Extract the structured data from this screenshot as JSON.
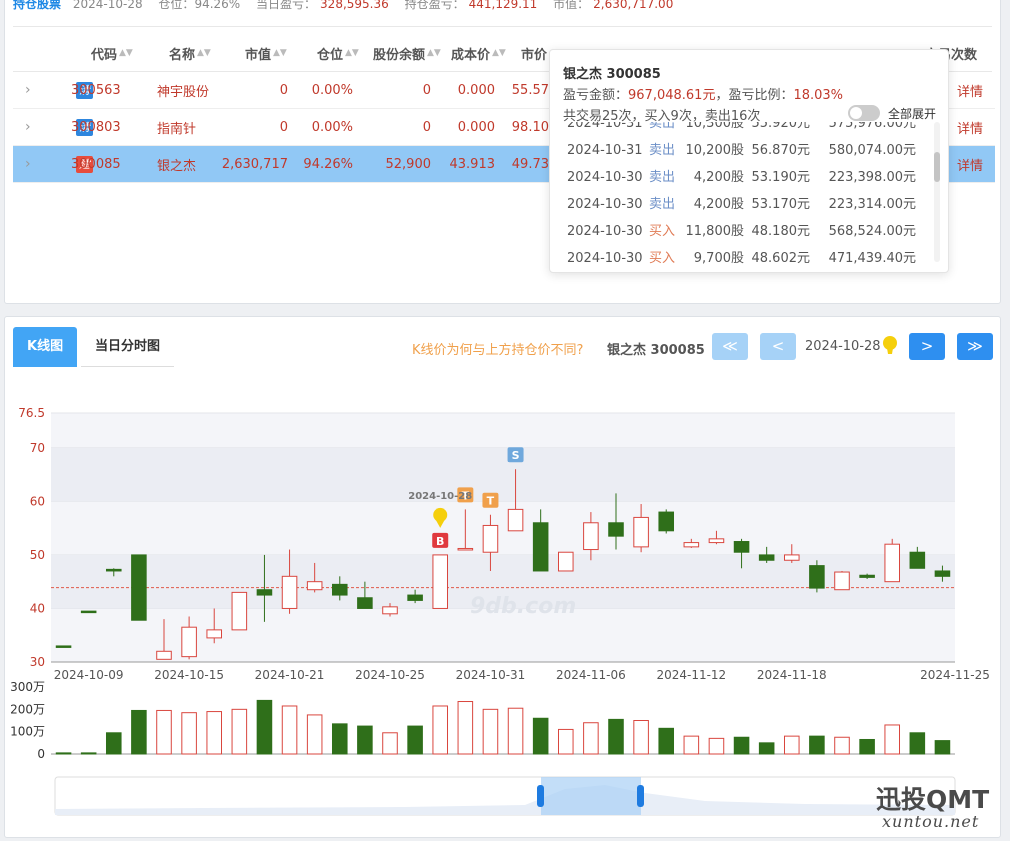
{
  "summary": {
    "label": "持仓股票",
    "date": "2024-10-28",
    "position_label": "仓位：",
    "position_value": "94.26%",
    "daily_pl_label": "当日盈亏：",
    "daily_pl_value": "328,595.36",
    "hold_pl_label": "持仓盈亏：",
    "hold_pl_value": "441,129.11",
    "mv_label": "市值：",
    "mv_value": "2,630,717.00"
  },
  "table": {
    "headers": {
      "code": "代码",
      "name": "名称",
      "mv": "市值",
      "pos": "仓位",
      "shares": "股份余额",
      "cost": "成本价",
      "price": "市价",
      "trades": "交易次数"
    },
    "rows": [
      {
        "code": "300563",
        "badge": "清",
        "badge_type": "clear",
        "name": "神宇股份",
        "mv": "0",
        "pos": "0.00%",
        "shares": "0",
        "cost": "0.000",
        "price": "55.57",
        "detail": "详情"
      },
      {
        "code": "300803",
        "badge": "清",
        "badge_type": "clear",
        "name": "指南针",
        "mv": "0",
        "pos": "0.00%",
        "shares": "0",
        "cost": "0.000",
        "price": "98.10",
        "detail": "详情"
      },
      {
        "code": "300085",
        "badge": "建",
        "badge_type": "build",
        "name": "银之杰",
        "mv": "2,630,717",
        "pos": "94.26%",
        "shares": "52,900",
        "cost": "43.913",
        "price": "49.73",
        "detail": "详情"
      }
    ]
  },
  "popup": {
    "title": "银之杰 300085",
    "pl_label": "盈亏金额：",
    "pl_value": "967,048.61元",
    "ratio_label": "，盈亏比例：",
    "ratio_value": "18.03%",
    "count_text": "共交易25次，买入9次，卖出16次",
    "toggle_label": "全部展开",
    "trades": [
      {
        "date": "2024-10-31",
        "side": "卖出",
        "type": "sell",
        "qty": "10,300股",
        "price": "55.920元",
        "amount": "575,976.00元"
      },
      {
        "date": "2024-10-31",
        "side": "卖出",
        "type": "sell",
        "qty": "10,200股",
        "price": "56.870元",
        "amount": "580,074.00元"
      },
      {
        "date": "2024-10-30",
        "side": "卖出",
        "type": "sell",
        "qty": "4,200股",
        "price": "53.190元",
        "amount": "223,398.00元"
      },
      {
        "date": "2024-10-30",
        "side": "卖出",
        "type": "sell",
        "qty": "4,200股",
        "price": "53.170元",
        "amount": "223,314.00元"
      },
      {
        "date": "2024-10-30",
        "side": "买入",
        "type": "buy",
        "qty": "11,800股",
        "price": "48.180元",
        "amount": "568,524.00元"
      },
      {
        "date": "2024-10-30",
        "side": "买入",
        "type": "buy",
        "qty": "9,700股",
        "price": "48.602元",
        "amount": "471,439.40元"
      }
    ]
  },
  "chart_tabs": {
    "kline": "K线图",
    "intraday": "当日分时图"
  },
  "chart_header": {
    "why_link": "K线价为何与上方持仓价不同?",
    "stock": "银之杰 300085",
    "first_btn": "≪",
    "prev_btn": "<",
    "date": "2024-10-28",
    "next_btn": ">",
    "last_btn": "≫"
  },
  "watermark": {
    "logo": "迅投QMT",
    "url": "xuntou.net",
    "site": "9db.com"
  },
  "colors": {
    "up": "#d9463e",
    "down": "#2f6f1a",
    "accent": "#42a5f5",
    "avgline": "#e05a4a"
  },
  "chart_data": {
    "type": "candlestick",
    "y_ticks": [
      "76.5",
      "70",
      "60",
      "50",
      "40",
      "30"
    ],
    "ylim": [
      30,
      76.5
    ],
    "x_ticks": [
      "2024-10-09",
      "2024-10-15",
      "2024-10-21",
      "2024-10-25",
      "2024-10-31",
      "2024-11-06",
      "2024-11-12",
      "2024-11-18",
      "2024-11-25"
    ],
    "cost_line": 43.9,
    "volume_ticks": [
      "300万",
      "200万",
      "100万",
      "0"
    ],
    "volume_max": 300,
    "candles": [
      {
        "o": 33,
        "c": 33,
        "h": 33,
        "l": 33,
        "v": 5,
        "up": false
      },
      {
        "o": 39.5,
        "c": 39.5,
        "h": 39.5,
        "l": 39.5,
        "v": 5,
        "up": false
      },
      {
        "o": 47.3,
        "c": 47,
        "h": 47.5,
        "l": 46,
        "v": 95,
        "up": false
      },
      {
        "o": 50,
        "c": 37.8,
        "h": 50,
        "l": 37.8,
        "v": 195,
        "up": false
      },
      {
        "o": 30.5,
        "c": 32,
        "h": 38,
        "l": 30.5,
        "v": 195,
        "up": true
      },
      {
        "o": 31,
        "c": 36.5,
        "h": 38.5,
        "l": 30.5,
        "v": 185,
        "up": true
      },
      {
        "o": 34.5,
        "c": 36,
        "h": 40,
        "l": 33.5,
        "v": 190,
        "up": true
      },
      {
        "o": 36,
        "c": 43,
        "h": 43,
        "l": 36,
        "v": 200,
        "up": true
      },
      {
        "o": 43.5,
        "c": 42.5,
        "h": 50,
        "l": 37.5,
        "v": 240,
        "up": false
      },
      {
        "o": 40,
        "c": 46,
        "h": 51,
        "l": 39,
        "v": 215,
        "up": true
      },
      {
        "o": 43.5,
        "c": 45,
        "h": 48.5,
        "l": 43,
        "v": 175,
        "up": true
      },
      {
        "o": 44.5,
        "c": 42.5,
        "h": 46,
        "l": 41.5,
        "v": 135,
        "up": false
      },
      {
        "o": 42,
        "c": 40,
        "h": 45,
        "l": 40,
        "v": 125,
        "up": false
      },
      {
        "o": 39,
        "c": 40.3,
        "h": 41,
        "l": 38.5,
        "v": 95,
        "up": true
      },
      {
        "o": 42.5,
        "c": 41.5,
        "h": 43.5,
        "l": 41,
        "v": 125,
        "up": false
      },
      {
        "o": 40,
        "c": 50,
        "h": 50,
        "l": 40,
        "v": 215,
        "up": true
      },
      {
        "o": 51,
        "c": 51.2,
        "h": 58.5,
        "l": 51,
        "v": 235,
        "up": true
      },
      {
        "o": 50.5,
        "c": 55.5,
        "h": 57.5,
        "l": 47,
        "v": 200,
        "up": true
      },
      {
        "o": 54.5,
        "c": 58.5,
        "h": 66,
        "l": 54.5,
        "v": 205,
        "up": true
      },
      {
        "o": 56,
        "c": 47,
        "h": 58.5,
        "l": 47,
        "v": 160,
        "up": false
      },
      {
        "o": 47,
        "c": 50.5,
        "h": 50.5,
        "l": 47,
        "v": 110,
        "up": true
      },
      {
        "o": 51,
        "c": 56,
        "h": 58,
        "l": 49,
        "v": 140,
        "up": true
      },
      {
        "o": 56,
        "c": 53.5,
        "h": 61.5,
        "l": 51,
        "v": 155,
        "up": false
      },
      {
        "o": 51.5,
        "c": 57,
        "h": 59.5,
        "l": 50.5,
        "v": 150,
        "up": true
      },
      {
        "o": 58,
        "c": 54.5,
        "h": 58.5,
        "l": 54,
        "v": 115,
        "up": false
      },
      {
        "o": 51.5,
        "c": 52.3,
        "h": 53,
        "l": 51.3,
        "v": 80,
        "up": true
      },
      {
        "o": 52.3,
        "c": 53,
        "h": 54.5,
        "l": 52,
        "v": 70,
        "up": true
      },
      {
        "o": 52.5,
        "c": 50.5,
        "h": 53,
        "l": 47.5,
        "v": 75,
        "up": false
      },
      {
        "o": 50,
        "c": 49,
        "h": 51.5,
        "l": 48.5,
        "v": 50,
        "up": false
      },
      {
        "o": 49,
        "c": 50,
        "h": 52,
        "l": 48.5,
        "v": 80,
        "up": true
      },
      {
        "o": 48,
        "c": 43.8,
        "h": 49,
        "l": 43,
        "v": 80,
        "up": false
      },
      {
        "o": 43.5,
        "c": 46.8,
        "h": 47,
        "l": 43.5,
        "v": 75,
        "up": true
      },
      {
        "o": 46.2,
        "c": 45.8,
        "h": 46.5,
        "l": 45.5,
        "v": 65,
        "up": false
      },
      {
        "o": 45,
        "c": 52,
        "h": 53,
        "l": 45,
        "v": 130,
        "up": true
      },
      {
        "o": 50.5,
        "c": 47.5,
        "h": 51.5,
        "l": 47.5,
        "v": 95,
        "up": false
      },
      {
        "o": 47,
        "c": 46,
        "h": 48,
        "l": 45,
        "v": 60,
        "up": false
      }
    ],
    "markers": [
      {
        "index": 15,
        "label": "B",
        "kind": "buy"
      },
      {
        "index": 16,
        "label": "T",
        "kind": "t"
      },
      {
        "index": 17,
        "label": "T",
        "kind": "t"
      },
      {
        "index": 18,
        "label": "S",
        "kind": "sell"
      }
    ],
    "marker_date": "2024-10-28",
    "current_index": 15
  }
}
